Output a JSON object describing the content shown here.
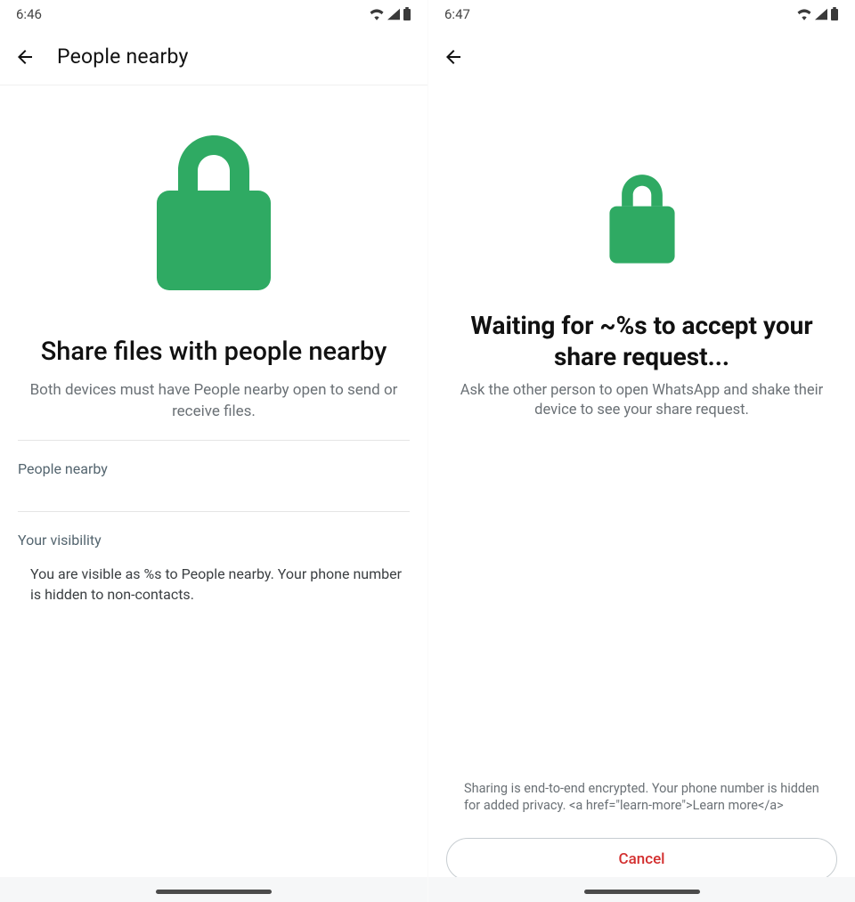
{
  "colors": {
    "accent_green": "#2faa63",
    "danger": "#d32f2f",
    "muted": "#6b7176",
    "section_head": "#54656f"
  },
  "left": {
    "status_time": "6:46",
    "appbar_title": "People nearby",
    "headline": "Share files with people nearby",
    "subtext": "Both devices must have People nearby open to send or receive files.",
    "section1_title": "People nearby",
    "section2_title": "Your visibility",
    "section2_body": "You are visible as %s to People nearby. Your phone number is hidden to non-contacts."
  },
  "right": {
    "status_time": "6:47",
    "headline": "Waiting for ~%s to accept your share request...",
    "subtext": "Ask the other person to open WhatsApp and shake their device to see your share request.",
    "legal": "Sharing is end-to-end encrypted. Your phone number is hidden for added privacy. <a href=\"learn-more\">Learn more</a>",
    "cancel_label": "Cancel"
  }
}
